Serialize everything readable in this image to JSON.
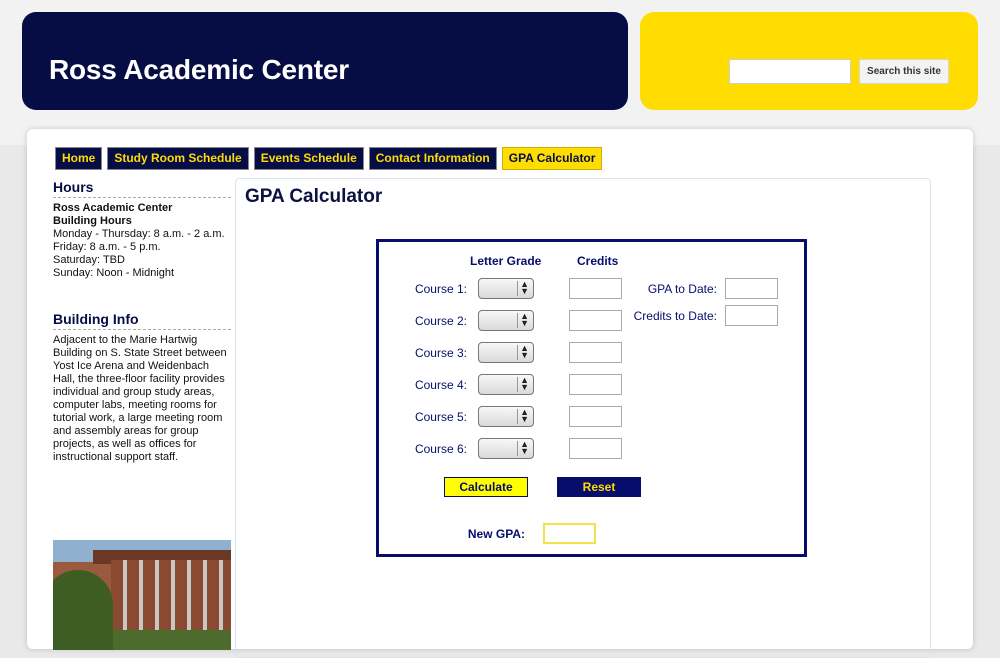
{
  "header": {
    "title": "Ross Academic Center"
  },
  "search": {
    "placeholder": "",
    "button_label": "Search this site"
  },
  "nav": {
    "tabs": [
      {
        "label": "Home",
        "active": false
      },
      {
        "label": "Study Room Schedule",
        "active": false
      },
      {
        "label": "Events Schedule",
        "active": false
      },
      {
        "label": "Contact Information",
        "active": false
      },
      {
        "label": "GPA Calculator",
        "active": true
      }
    ]
  },
  "sidebar": {
    "hours": {
      "heading": "Hours",
      "building": "Ross Academic Center",
      "subheading": "Building Hours",
      "lines": [
        "Monday - Thursday: 8 a.m. - 2 a.m.",
        "Friday: 8 a.m. - 5 p.m.",
        "Saturday: TBD",
        "Sunday: Noon - Midnight"
      ]
    },
    "building_info": {
      "heading": "Building Info",
      "text": "Adjacent to the Marie Hartwig Building on S. State Street between Yost Ice Arena and Weidenbach Hall, the three-floor facility provides individual and group study areas, computer labs, meeting rooms for tutorial work, a large meeting room and assembly areas for group projects, as well as offices for instructional support staff."
    }
  },
  "main": {
    "title": "GPA Calculator",
    "calculator": {
      "letter_grade_header": "Letter Grade",
      "credits_header": "Credits",
      "courses": [
        {
          "label": "Course 1:"
        },
        {
          "label": "Course 2:"
        },
        {
          "label": "Course 3:"
        },
        {
          "label": "Course 4:"
        },
        {
          "label": "Course 5:"
        },
        {
          "label": "Course 6:"
        }
      ],
      "gpa_to_date_label": "GPA to Date:",
      "credits_to_date_label": "Credits to Date:",
      "calculate_label": "Calculate",
      "reset_label": "Reset",
      "new_gpa_label": "New GPA:"
    }
  },
  "colors": {
    "navy": "#060d45",
    "yellow": "#ffdd00",
    "form_navy": "#060d6a"
  }
}
